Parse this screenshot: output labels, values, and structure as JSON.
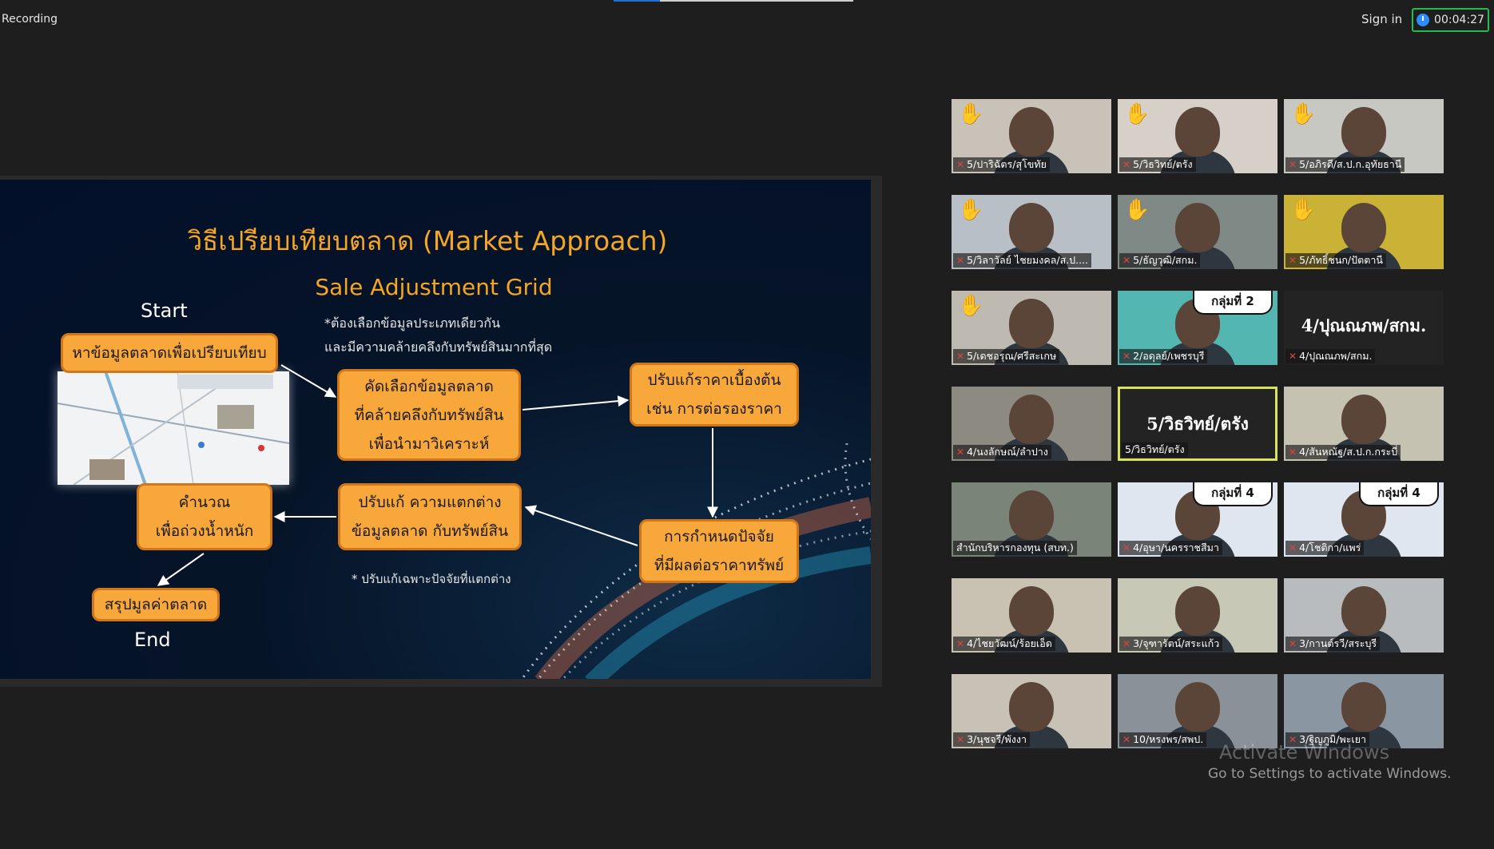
{
  "window": {
    "recording_label": "Recording",
    "signin_label": "Sign in",
    "timer": "00:04:27"
  },
  "slide": {
    "title": "วิธีเปรียบเทียบตลาด (Market Approach)",
    "subtitle": "Sale Adjustment Grid",
    "start": "Start",
    "end": "End",
    "note_top": "*ต้องเลือกข้อมูลประเภทเดียวกัน\nและมีความคล้ายคลึงกับทรัพย์สินมากที่สุด",
    "note_bottom": "* ปรับแก้เฉพาะปัจจัยที่แตกต่าง",
    "steps": {
      "find_data": "หาข้อมูลตลาดเพื่อเปรียบเทียบ",
      "select_data": "คัดเลือกข้อมูลตลาด\nที่คล้ายคลึงกับทรัพย์สิน\nเพื่อนำมาวิเคราะห์",
      "adjust_price": "ปรับแก้ราคาเบื้องต้น\nเช่น การต่อรองราคา",
      "set_factors": "การกำหนดปัจจัย\nที่มีผลต่อราคาทรัพย์",
      "adjust_diff": "ปรับแก้ ความแตกต่าง\nข้อมูลตลาด กับทรัพย์สิน",
      "weight": "คำนวณ\nเพื่อถ่วงน้ำหนัก",
      "summary": "สรุปมูลค่าตลาด"
    }
  },
  "participants": [
    {
      "name": "5/ปาริฉัตร/สุโขทัย",
      "hand": true,
      "muted": true,
      "bg": "#c9c2b8"
    },
    {
      "name": "5/วิธวิทย์/ตรัง",
      "hand": true,
      "muted": true,
      "bg": "#d6d0c8"
    },
    {
      "name": "5/อภิรดี/ส.ป.ก.อุทัยธานี",
      "hand": true,
      "muted": true,
      "bg": "#c8c8c2"
    },
    {
      "name": "5/วิลาวัลย์ ไชยมงคล/ส.ป....",
      "hand": true,
      "muted": true,
      "bg": "#b9bfc6"
    },
    {
      "name": "5/ธัญวุฒิ/สกม.",
      "hand": true,
      "muted": true,
      "bg": "#7f8a86"
    },
    {
      "name": "5/ภัทธิ์ชนก/ปัตตานี",
      "hand": true,
      "muted": true,
      "bg": "#c9b236"
    },
    {
      "name": "5/เดชอรุณ/ศรีสะเกษ",
      "hand": true,
      "muted": true,
      "bg": "#bfbab1"
    },
    {
      "name": "2/อดุลย์/เพชรบุรี",
      "hand": false,
      "muted": true,
      "bg": "#54b6b0",
      "bubble": "กลุ่มที่ 2"
    },
    {
      "name": "4/ปุณณภพ/สกม.",
      "hand": false,
      "muted": true,
      "bg": "#232323",
      "big": "4/ปุณณภพ/สกม."
    },
    {
      "name": "4/นงลักษณ์/ลำปาง",
      "hand": false,
      "muted": true,
      "bg": "#8d8a82"
    },
    {
      "name": "5/วิธวิทย์/ตรัง",
      "hand": false,
      "muted": false,
      "bg": "#232323",
      "big": "5/วิธวิทย์/ตรัง",
      "active": true
    },
    {
      "name": "4/สันหณัฐ/ส.ป.ก.กระบี่",
      "hand": false,
      "muted": true,
      "bg": "#c6c2b2"
    },
    {
      "name": "สำนักบริหารกองทุน (สบท.)",
      "hand": false,
      "muted": false,
      "bg": "#7b8478"
    },
    {
      "name": "4/อุษา/นครราชสีมา",
      "hand": false,
      "muted": true,
      "bg": "#dfe6f0",
      "bubble": "กลุ่มที่ 4"
    },
    {
      "name": "4/โชติกา/แพร่",
      "hand": false,
      "muted": true,
      "bg": "#dfe6f0",
      "bubble": "กลุ่มที่ 4"
    },
    {
      "name": "4/ไชยวัฒน์/ร้อยเอ็ด",
      "hand": false,
      "muted": true,
      "bg": "#c9c1b2"
    },
    {
      "name": "3/จุฑารัตน์/สระแก้ว",
      "hand": false,
      "muted": true,
      "bg": "#c7c9b6"
    },
    {
      "name": "3/กานต์รวี/สระบุรี",
      "hand": false,
      "muted": true,
      "bg": "#b8bcbf"
    },
    {
      "name": "3/นุชจรี/พังงา",
      "hand": false,
      "muted": true,
      "bg": "#c8c2b6"
    },
    {
      "name": "10/หรงพร/สพป.",
      "hand": false,
      "muted": true,
      "bg": "#8a9198"
    },
    {
      "name": "3/ฐิญภูมิ/พะเยา",
      "hand": false,
      "muted": true,
      "bg": "#8b96a3"
    }
  ],
  "watermark": {
    "line1": "Activate Windows",
    "line2": "Go to Settings to activate Windows."
  }
}
